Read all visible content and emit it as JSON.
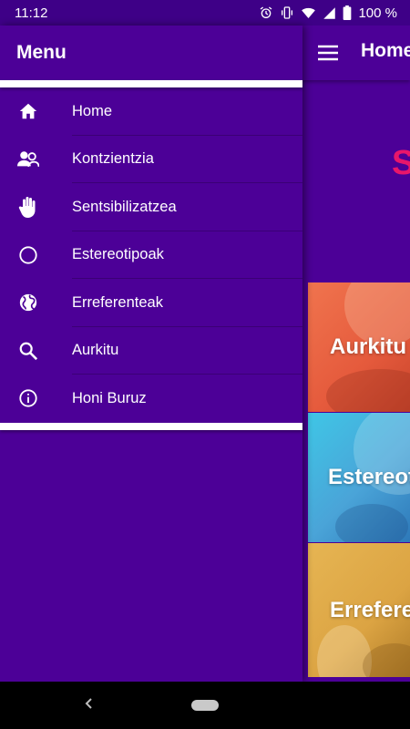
{
  "status_bar": {
    "time": "11:12",
    "battery": "100 %",
    "icons": [
      "alarm-icon",
      "vibrate-icon",
      "wifi-icon",
      "signal-icon",
      "battery-icon"
    ]
  },
  "app": {
    "title": "Home",
    "hero_text": "S",
    "cards": [
      {
        "label": "Aurkitu",
        "color": "#e55a3c"
      },
      {
        "label": "Estereotipoak",
        "color": "#4aa4d8"
      },
      {
        "label": "Erreferenteak",
        "color": "#dca443"
      }
    ]
  },
  "drawer": {
    "title": "Menu",
    "items": [
      {
        "label": "Home",
        "icon": "home-icon"
      },
      {
        "label": "Kontzientzia",
        "icon": "people-icon"
      },
      {
        "label": "Sentsibilizatzea",
        "icon": "hand-icon"
      },
      {
        "label": "Estereotipoak",
        "icon": "circle-icon"
      },
      {
        "label": "Erreferenteak",
        "icon": "globe-icon"
      },
      {
        "label": "Aurkitu",
        "icon": "search-icon"
      },
      {
        "label": "Honi Buruz",
        "icon": "info-icon"
      }
    ]
  },
  "colors": {
    "primary": "#4c0097",
    "status_bar": "#3e0087",
    "accent": "#e8166a"
  }
}
